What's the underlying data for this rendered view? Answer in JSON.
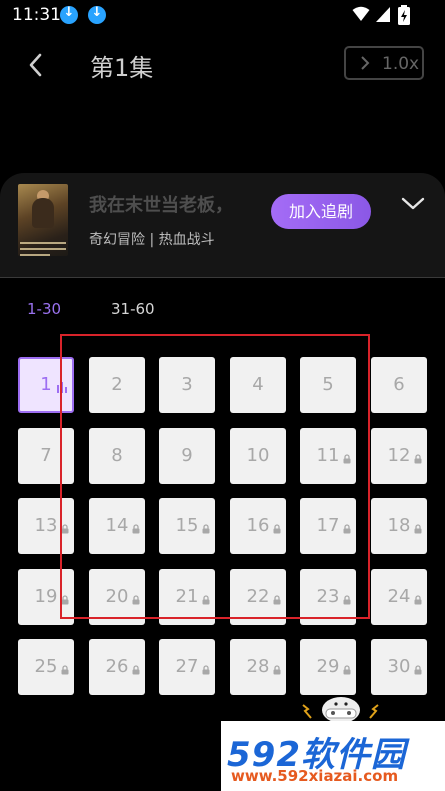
{
  "status_bar": {
    "time": "11:31",
    "download_icons": [
      "download-icon",
      "download-icon"
    ],
    "system_icons": [
      "wifi-icon",
      "signal-icon",
      "battery-icon"
    ]
  },
  "header": {
    "back_icon": "chevron-left-icon",
    "title": "第1集",
    "speed_label": "1.0x"
  },
  "show": {
    "title": "我在末世当老板，",
    "tags": "奇幻冒险 | 热血战斗",
    "follow_label": "加入追剧",
    "poster_text": "我在末世当老板 当上全世界最强领袖"
  },
  "ranges": [
    {
      "label": "1-30",
      "active": true
    },
    {
      "label": "31-60",
      "active": false
    }
  ],
  "episodes": [
    {
      "n": "1",
      "locked": false,
      "playing": true
    },
    {
      "n": "2",
      "locked": false
    },
    {
      "n": "3",
      "locked": false
    },
    {
      "n": "4",
      "locked": false
    },
    {
      "n": "5",
      "locked": false
    },
    {
      "n": "6",
      "locked": false
    },
    {
      "n": "7",
      "locked": false
    },
    {
      "n": "8",
      "locked": false
    },
    {
      "n": "9",
      "locked": false
    },
    {
      "n": "10",
      "locked": false
    },
    {
      "n": "11",
      "locked": true
    },
    {
      "n": "12",
      "locked": true
    },
    {
      "n": "13",
      "locked": true
    },
    {
      "n": "14",
      "locked": true
    },
    {
      "n": "15",
      "locked": true
    },
    {
      "n": "16",
      "locked": true
    },
    {
      "n": "17",
      "locked": true
    },
    {
      "n": "18",
      "locked": true
    },
    {
      "n": "19",
      "locked": true
    },
    {
      "n": "20",
      "locked": true
    },
    {
      "n": "21",
      "locked": true
    },
    {
      "n": "22",
      "locked": true
    },
    {
      "n": "23",
      "locked": true
    },
    {
      "n": "24",
      "locked": true
    },
    {
      "n": "25",
      "locked": true
    },
    {
      "n": "26",
      "locked": true
    },
    {
      "n": "27",
      "locked": true
    },
    {
      "n": "28",
      "locked": true
    },
    {
      "n": "29",
      "locked": true
    },
    {
      "n": "30",
      "locked": true
    }
  ],
  "watermark": {
    "brand": "592软件园",
    "url": "www.592xiazai.com"
  },
  "colors": {
    "accent": "#9d6ef2",
    "follow_button": "#a46cf6",
    "highlight_box": "#d9232a"
  }
}
